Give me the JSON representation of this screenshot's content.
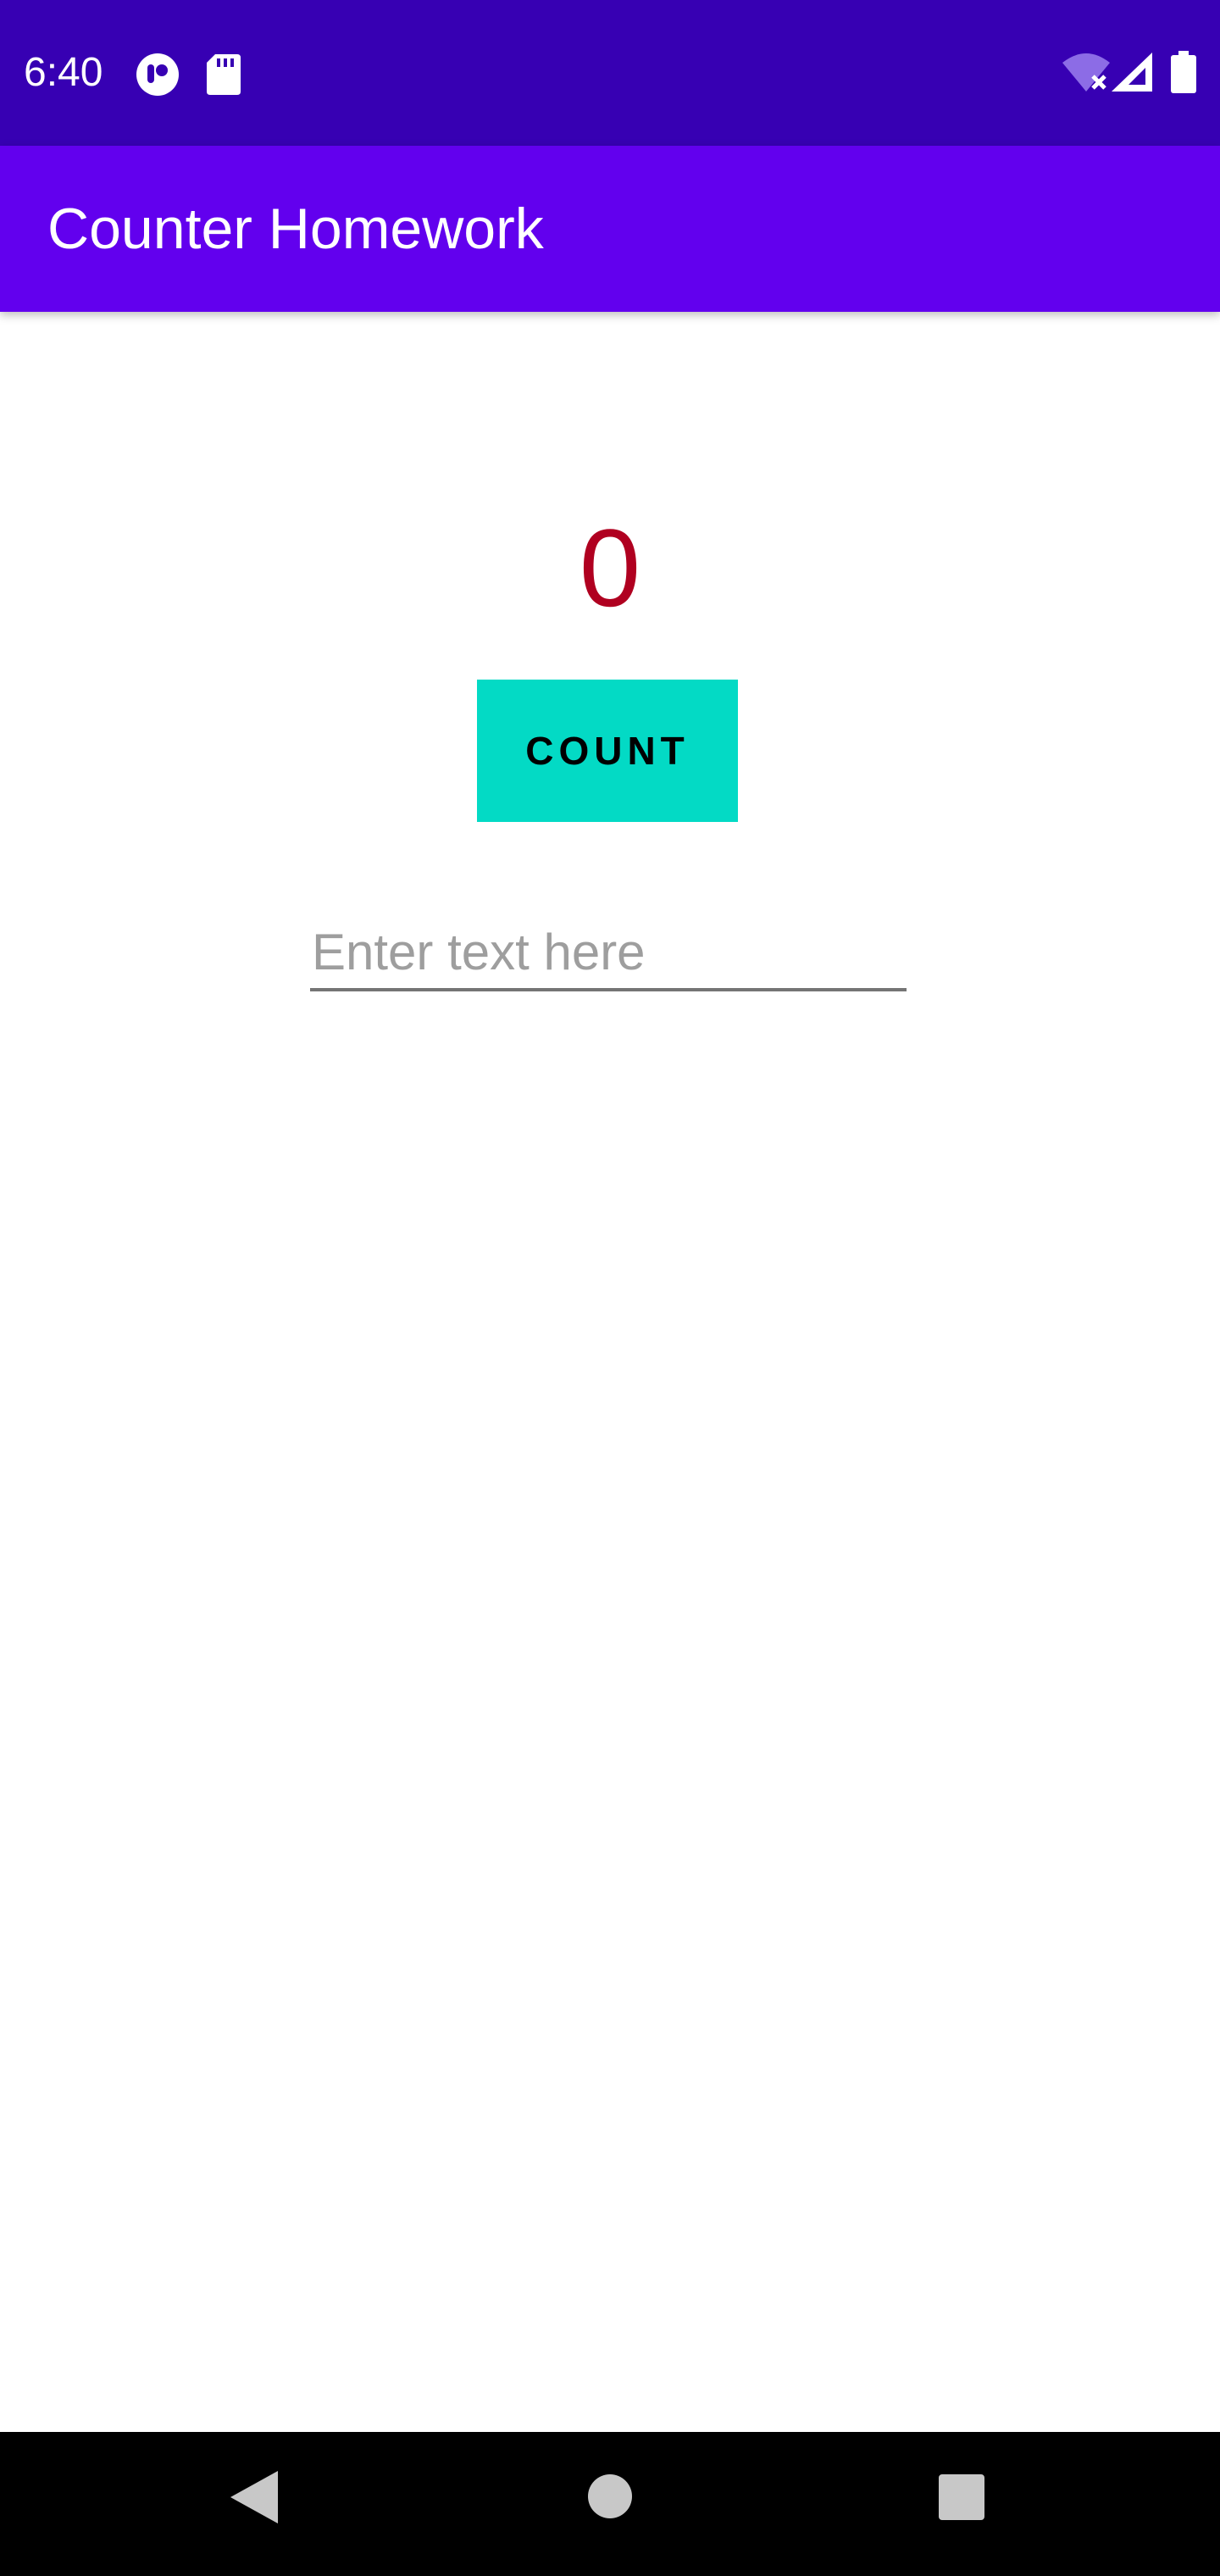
{
  "status_bar": {
    "time": "6:40",
    "icons": [
      "tiktok-notification-icon",
      "sd-card-icon",
      "wifi-off-icon",
      "cell-signal-icon",
      "battery-icon"
    ]
  },
  "app_bar": {
    "title": "Counter Homework"
  },
  "main": {
    "count_value": "0",
    "count_button_label": "COUNT",
    "text_input_placeholder": "Enter text here",
    "text_input_value": ""
  },
  "nav_bar": {
    "buttons": [
      "back-button",
      "home-button",
      "recents-button"
    ]
  },
  "colors": {
    "status_bar": "#3700B3",
    "app_bar": "#6200EE",
    "count_text": "#B00020",
    "button": "#03DAC5"
  }
}
